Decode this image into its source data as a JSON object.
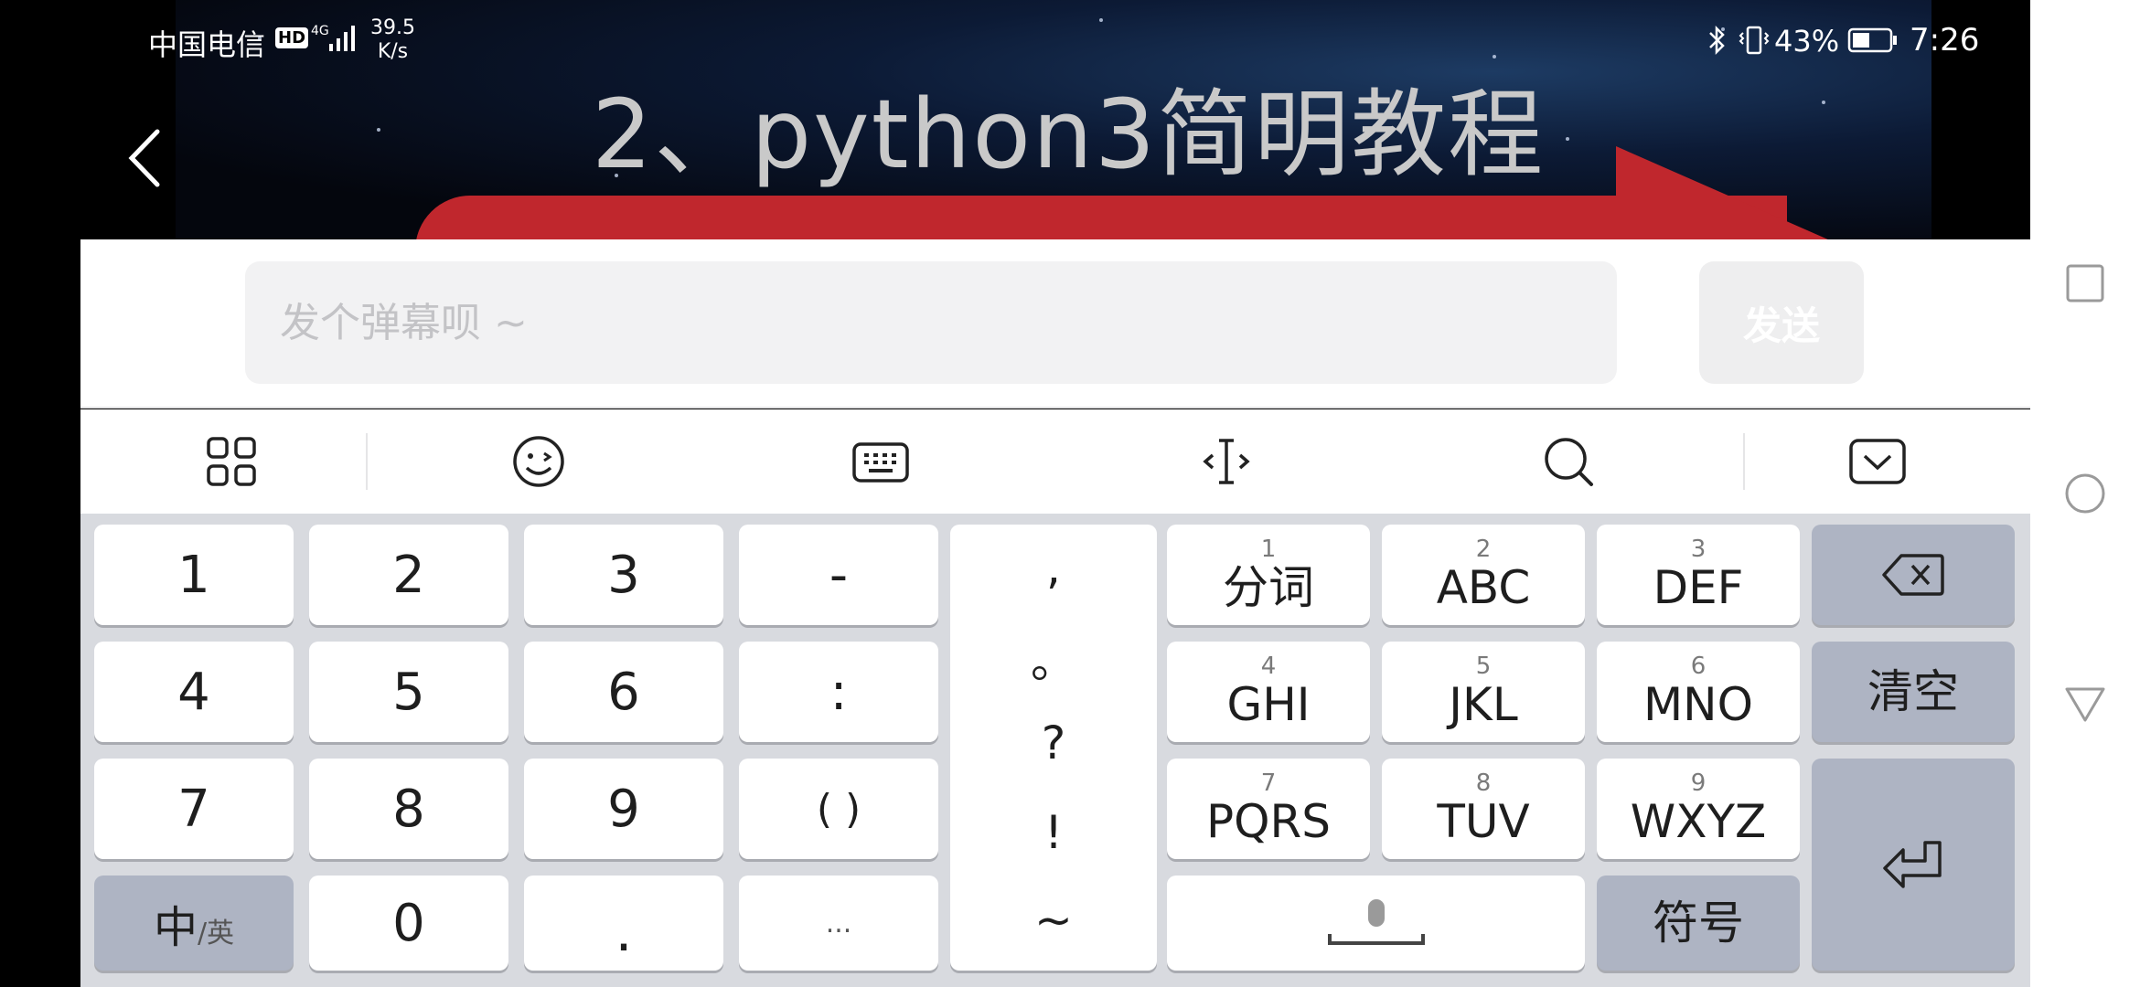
{
  "status_bar": {
    "carrier": "中国电信",
    "hd_badge": "HD",
    "network_type": "4G",
    "speed_value": "39.5",
    "speed_unit": "K/s",
    "battery_percent": "43%",
    "time": "7:26"
  },
  "video": {
    "title_overlay": "2、python3简明教程"
  },
  "danmaku": {
    "placeholder": "发个弹幕呗 ~",
    "send_label": "发送"
  },
  "toolbar": {
    "icons": [
      "grid-menu-icon",
      "emoji-icon",
      "keyboard-icon",
      "cursor-move-icon",
      "search-icon",
      "collapse-keyboard-icon"
    ]
  },
  "keyboard": {
    "digit_keys": [
      "1",
      "2",
      "3",
      "4",
      "5",
      "6",
      "7",
      "8",
      "9",
      "0"
    ],
    "symbol_keys": [
      "-",
      ":",
      "( )",
      "...",
      "."
    ],
    "punctuation": [
      ",",
      "。",
      "?",
      "!",
      "~"
    ],
    "t9_keys": [
      {
        "num": "1",
        "label": "分词"
      },
      {
        "num": "2",
        "label": "ABC"
      },
      {
        "num": "3",
        "label": "DEF"
      },
      {
        "num": "4",
        "label": "GHI"
      },
      {
        "num": "5",
        "label": "JKL"
      },
      {
        "num": "6",
        "label": "MNO"
      },
      {
        "num": "7",
        "label": "PQRS"
      },
      {
        "num": "8",
        "label": "TUV"
      },
      {
        "num": "9",
        "label": "WXYZ"
      }
    ],
    "lang_switch_main": "中",
    "lang_switch_sub": "/英",
    "clear_label": "清空",
    "symbols_label": "符号"
  }
}
